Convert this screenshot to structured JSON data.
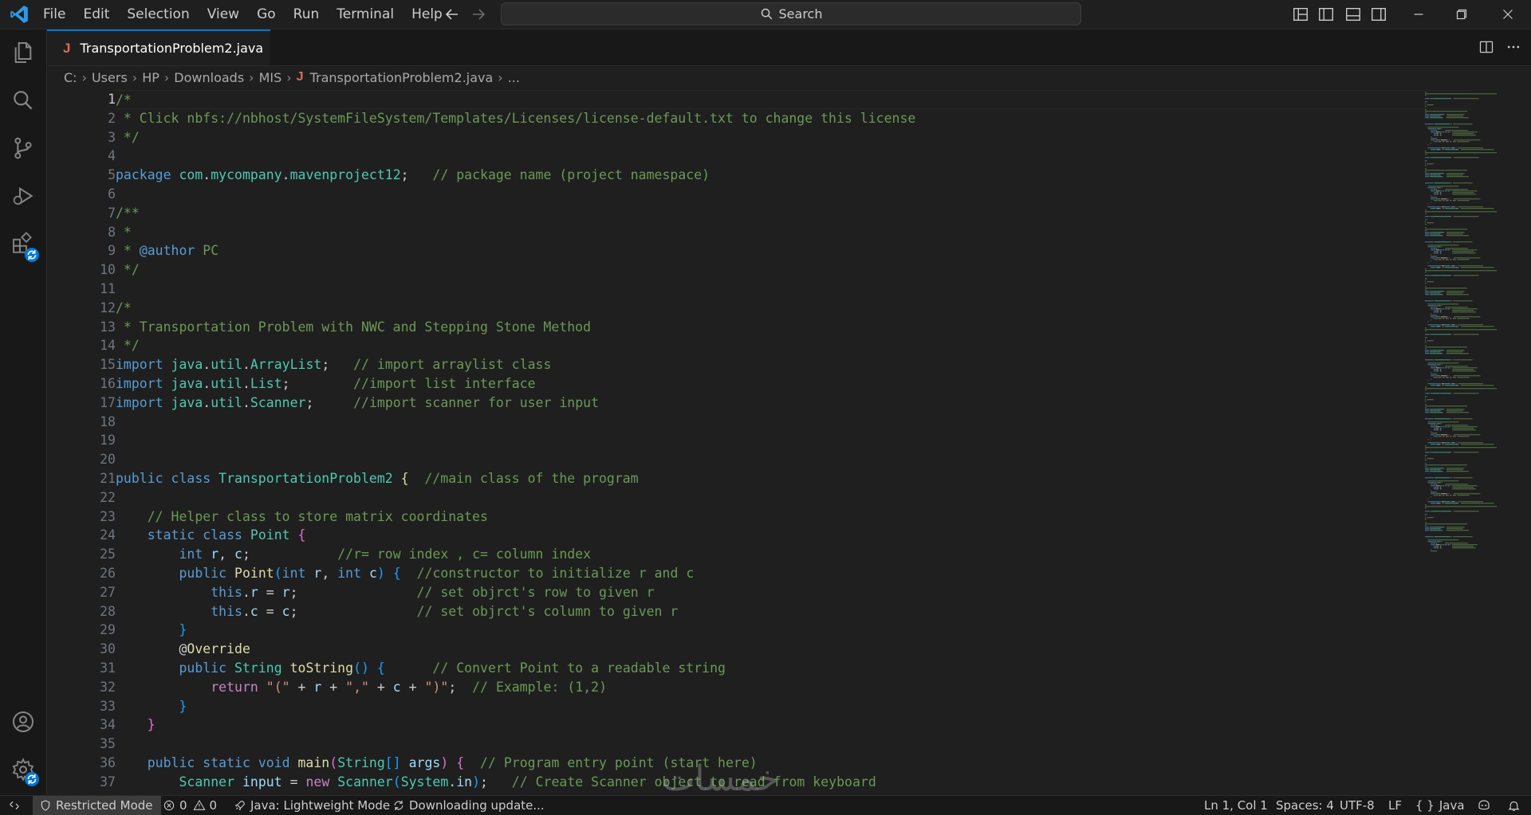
{
  "menu": [
    "File",
    "Edit",
    "Selection",
    "View",
    "Go",
    "Run",
    "Terminal",
    "Help"
  ],
  "search": {
    "label": "Search"
  },
  "tab": {
    "file_name": "TransportationProblem2.java",
    "icon_letter": "J"
  },
  "breadcrumb": {
    "parts": [
      "C:",
      "Users",
      "HP",
      "Downloads",
      "MIS"
    ],
    "file": "TransportationProblem2.java",
    "tail": "..."
  },
  "editor": {
    "current_line": 1,
    "visible_line_numbers": [
      1,
      2,
      3,
      4,
      5,
      6,
      7,
      8,
      9,
      10,
      11,
      12,
      13,
      14,
      15,
      16,
      17,
      18,
      19,
      20,
      21,
      22,
      23,
      24,
      25,
      26,
      27,
      28,
      29,
      30,
      31,
      32,
      33,
      34,
      35,
      36,
      37
    ],
    "lines": [
      [
        [
          "cm",
          "/*"
        ]
      ],
      [
        [
          "cm",
          " * Click nbfs://nbhost/SystemFileSystem/Templates/Licenses/license-default.txt to change this license"
        ]
      ],
      [
        [
          "cm",
          " */"
        ]
      ],
      [],
      [
        [
          "kw",
          "package "
        ],
        [
          "ty",
          "com"
        ],
        [
          "",
          "."
        ],
        [
          "ty",
          "mycompany"
        ],
        [
          "",
          "."
        ],
        [
          "ty",
          "mavenproject12"
        ],
        [
          "",
          ";   "
        ],
        [
          "cm",
          "// package name (project namespace)"
        ]
      ],
      [],
      [
        [
          "cm",
          "/**"
        ]
      ],
      [
        [
          "cm",
          " *"
        ]
      ],
      [
        [
          "cm",
          " * "
        ],
        [
          "doc",
          "@author"
        ],
        [
          "cm",
          " PC"
        ]
      ],
      [
        [
          "cm",
          " */"
        ]
      ],
      [],
      [
        [
          "cm",
          "/*"
        ]
      ],
      [
        [
          "cm",
          " * Transportation Problem with NWC and Stepping Stone Method"
        ]
      ],
      [
        [
          "cm",
          " */"
        ]
      ],
      [
        [
          "kw",
          "import "
        ],
        [
          "ty",
          "java"
        ],
        [
          "",
          "."
        ],
        [
          "ty",
          "util"
        ],
        [
          "",
          "."
        ],
        [
          "ty",
          "ArrayList"
        ],
        [
          "",
          ";   "
        ],
        [
          "cm",
          "// import arraylist class"
        ]
      ],
      [
        [
          "kw",
          "import "
        ],
        [
          "ty",
          "java"
        ],
        [
          "",
          "."
        ],
        [
          "ty",
          "util"
        ],
        [
          "",
          "."
        ],
        [
          "ty",
          "List"
        ],
        [
          "",
          ";        "
        ],
        [
          "cm",
          "//import list interface"
        ]
      ],
      [
        [
          "kw",
          "import "
        ],
        [
          "ty",
          "java"
        ],
        [
          "",
          "."
        ],
        [
          "ty",
          "util"
        ],
        [
          "",
          "."
        ],
        [
          "ty",
          "Scanner"
        ],
        [
          "",
          ";     "
        ],
        [
          "cm",
          "//import scanner for user input"
        ]
      ],
      [],
      [],
      [],
      [
        [
          "kw",
          "public class "
        ],
        [
          "ty",
          "TransportationProblem2"
        ],
        [
          "",
          " "
        ],
        [
          "fn",
          "{"
        ],
        [
          "",
          "  "
        ],
        [
          "cm",
          "//main class of the program"
        ]
      ],
      [],
      [
        [
          "",
          "    "
        ],
        [
          "cm",
          "// Helper class to store matrix coordinates"
        ]
      ],
      [
        [
          "",
          "    "
        ],
        [
          "kw",
          "static class "
        ],
        [
          "ty",
          "Point"
        ],
        [
          "",
          " "
        ],
        [
          "br",
          "{"
        ]
      ],
      [
        [
          "",
          "        "
        ],
        [
          "kw",
          "int "
        ],
        [
          "var",
          "r"
        ],
        [
          "",
          ", "
        ],
        [
          "var",
          "c"
        ],
        [
          "",
          ";           "
        ],
        [
          "cm",
          "//r= row index , c= column index"
        ]
      ],
      [
        [
          "",
          "        "
        ],
        [
          "kw",
          "public "
        ],
        [
          "fn",
          "Point"
        ],
        [
          "br2",
          "("
        ],
        [
          "kw",
          "int "
        ],
        [
          "var",
          "r"
        ],
        [
          "",
          ", "
        ],
        [
          "kw",
          "int "
        ],
        [
          "var",
          "c"
        ],
        [
          "br2",
          ")"
        ],
        [
          "",
          " "
        ],
        [
          "br2",
          "{"
        ],
        [
          "",
          "  "
        ],
        [
          "cm",
          "//constructor to initialize r and c"
        ]
      ],
      [
        [
          "",
          "            "
        ],
        [
          "kw",
          "this"
        ],
        [
          "",
          "."
        ],
        [
          "var",
          "r"
        ],
        [
          "",
          " = "
        ],
        [
          "var",
          "r"
        ],
        [
          "",
          ";               "
        ],
        [
          "cm",
          "// set objrct's row to given r"
        ]
      ],
      [
        [
          "",
          "            "
        ],
        [
          "kw",
          "this"
        ],
        [
          "",
          "."
        ],
        [
          "var",
          "c"
        ],
        [
          "",
          " = "
        ],
        [
          "var",
          "c"
        ],
        [
          "",
          ";               "
        ],
        [
          "cm",
          "// set objrct's column to given r"
        ]
      ],
      [
        [
          "",
          "        "
        ],
        [
          "br2",
          "}"
        ]
      ],
      [
        [
          "",
          "        "
        ],
        [
          "",
          "@"
        ],
        [
          "ann",
          "Override"
        ]
      ],
      [
        [
          "",
          "        "
        ],
        [
          "kw",
          "public "
        ],
        [
          "ty",
          "String "
        ],
        [
          "fn",
          "toString"
        ],
        [
          "br2",
          "()"
        ],
        [
          "",
          " "
        ],
        [
          "br2",
          "{"
        ],
        [
          "",
          "      "
        ],
        [
          "cm",
          "// Convert Point to a readable string"
        ]
      ],
      [
        [
          "",
          "            "
        ],
        [
          "ctl",
          "return "
        ],
        [
          "st",
          "\"(\""
        ],
        [
          "",
          " + "
        ],
        [
          "var",
          "r"
        ],
        [
          "",
          " + "
        ],
        [
          "st",
          "\",\""
        ],
        [
          "",
          " + "
        ],
        [
          "var",
          "c"
        ],
        [
          "",
          " + "
        ],
        [
          "st",
          "\")\""
        ],
        [
          "",
          ";  "
        ],
        [
          "cm",
          "// Example: (1,2)"
        ]
      ],
      [
        [
          "",
          "        "
        ],
        [
          "br2",
          "}"
        ]
      ],
      [
        [
          "",
          "    "
        ],
        [
          "br",
          "}"
        ]
      ],
      [],
      [
        [
          "",
          "    "
        ],
        [
          "kw",
          "public static void "
        ],
        [
          "fn",
          "main"
        ],
        [
          "br",
          "("
        ],
        [
          "ty",
          "String"
        ],
        [
          "br2",
          "[]"
        ],
        [
          "",
          " "
        ],
        [
          "var",
          "args"
        ],
        [
          "br",
          ")"
        ],
        [
          "",
          " "
        ],
        [
          "br",
          "{"
        ],
        [
          "",
          "  "
        ],
        [
          "cm",
          "// Program entry point (start here)"
        ]
      ],
      [
        [
          "",
          "        "
        ],
        [
          "ty",
          "Scanner "
        ],
        [
          "var",
          "input"
        ],
        [
          "",
          " = "
        ],
        [
          "ctl",
          "new "
        ],
        [
          "ty",
          "Scanner"
        ],
        [
          "br2",
          "("
        ],
        [
          "ty",
          "System"
        ],
        [
          "",
          "."
        ],
        [
          "var",
          "in"
        ],
        [
          "br2",
          ")"
        ],
        [
          "",
          ";   "
        ],
        [
          "cm",
          "// Create Scanner object to read from keyboard"
        ]
      ]
    ]
  },
  "status": {
    "restricted": "Restricted Mode",
    "errors": "0",
    "warnings": "0",
    "java_mode": "Java: Lightweight Mode",
    "downloading": "Downloading update...",
    "position": "Ln 1, Col 1",
    "spaces": "Spaces: 4",
    "encoding": "UTF-8",
    "eol": "LF",
    "language": "Java",
    "language_icon": "{ }"
  },
  "watermark": "خمسات",
  "colors": {
    "accent": "#0078d4",
    "java_icon": "#e06c5a",
    "keyword": "#569cd6",
    "comment": "#6a9955",
    "type": "#4ec9b0"
  }
}
